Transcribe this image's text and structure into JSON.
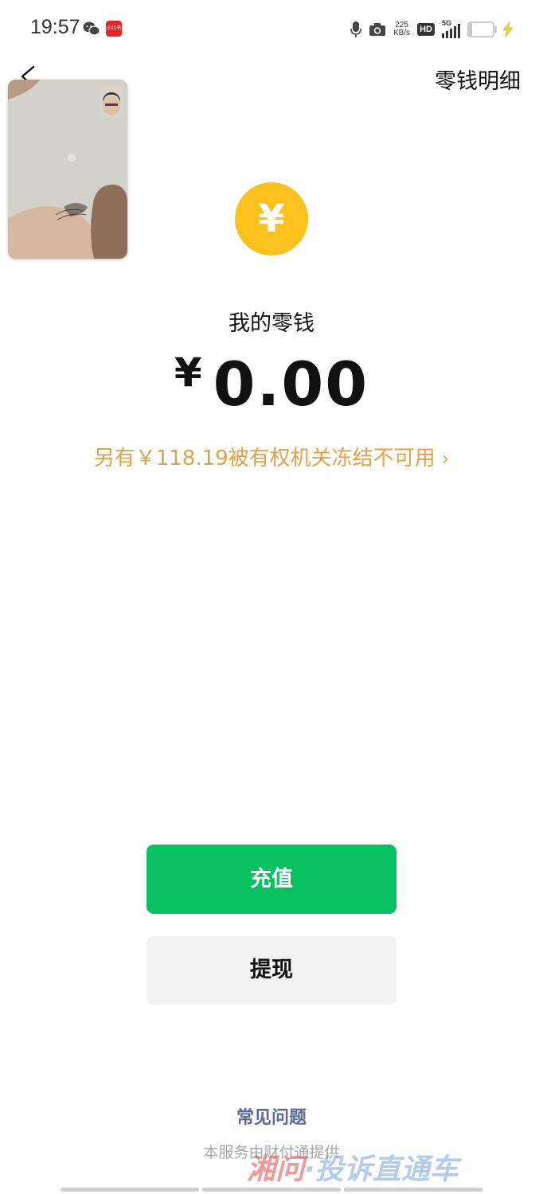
{
  "status_bar": {
    "time": "19:57",
    "app_icon_label": "小红书",
    "net_speed_value": "225",
    "net_speed_unit": "KB/s",
    "hd_label": "HD",
    "network_label": "5G",
    "battery_level": "12",
    "battery_percent": 12
  },
  "nav": {
    "back_icon": "back-chevron-icon",
    "right_label": "零钱明细"
  },
  "video_overlay": {
    "icon": "video-call-preview"
  },
  "coin": {
    "symbol": "¥",
    "color": "#fbc11e"
  },
  "balance": {
    "title": "我的零钱",
    "currency": "¥",
    "amount": "0.00"
  },
  "frozen_notice": {
    "text": "另有￥118.19被有权机关冻结不可用",
    "chevron": "›",
    "color": "#e2a04a"
  },
  "buttons": {
    "recharge_label": "充值",
    "withdraw_label": "提现",
    "recharge_color": "#07c160"
  },
  "footer": {
    "faq_label": "常见问题",
    "provider_note": "本服务由财付通提供"
  },
  "watermark": {
    "text_part1": "湘问",
    "text_part2": "·投诉直通车"
  }
}
